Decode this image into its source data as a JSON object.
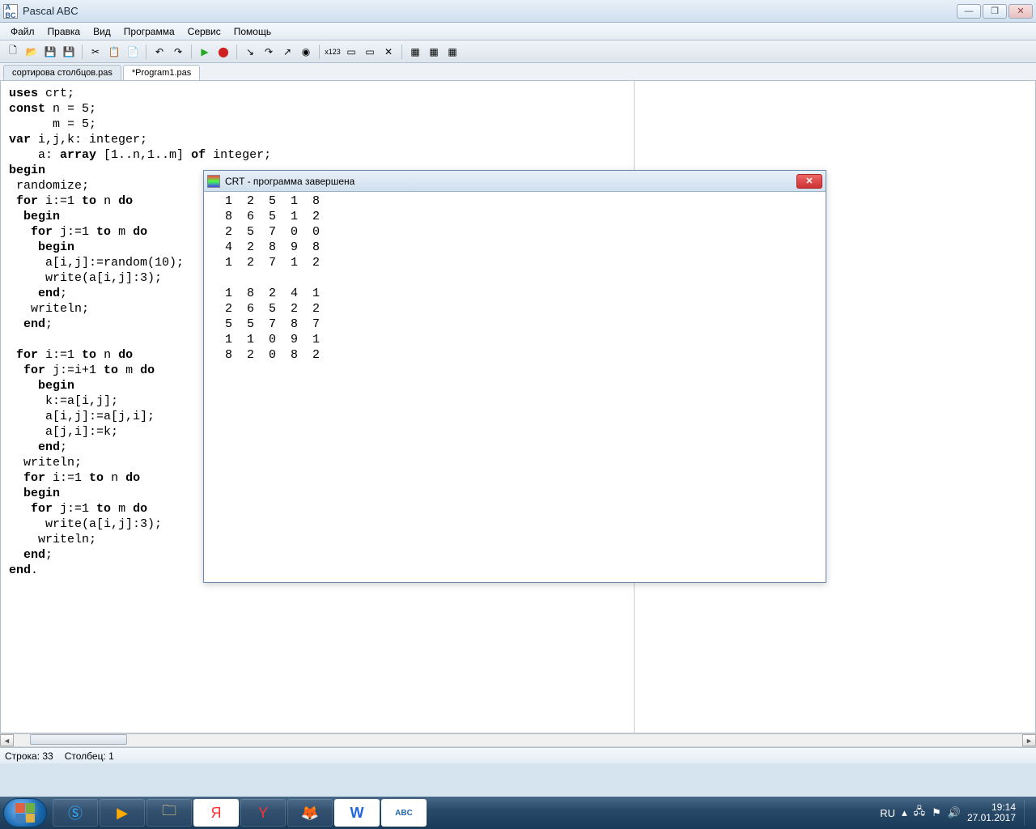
{
  "app": {
    "title": "Pascal ABC"
  },
  "menu": [
    "Файл",
    "Правка",
    "Вид",
    "Программа",
    "Сервис",
    "Помощь"
  ],
  "tabs": [
    {
      "label": "сортирова столбцов.pas",
      "active": false
    },
    {
      "label": "*Program1.pas",
      "active": true
    }
  ],
  "code_lines": [
    [
      [
        "kw",
        "uses"
      ],
      [
        "",
        " crt;"
      ]
    ],
    [
      [
        "kw",
        "const"
      ],
      [
        "",
        " n = 5;"
      ]
    ],
    [
      [
        "",
        "      m = 5;"
      ]
    ],
    [
      [
        "kw",
        "var"
      ],
      [
        "",
        " i,j,k: integer;"
      ]
    ],
    [
      [
        "",
        "    a: "
      ],
      [
        "kw",
        "array"
      ],
      [
        "",
        " [1..n,1..m] "
      ],
      [
        "kw",
        "of"
      ],
      [
        "",
        " integer;"
      ]
    ],
    [
      [
        "kw",
        "begin"
      ]
    ],
    [
      [
        "",
        " randomize;"
      ]
    ],
    [
      [
        "",
        " "
      ],
      [
        "kw",
        "for"
      ],
      [
        "",
        " i:=1 "
      ],
      [
        "kw",
        "to"
      ],
      [
        "",
        " n "
      ],
      [
        "kw",
        "do"
      ]
    ],
    [
      [
        "",
        "  "
      ],
      [
        "kw",
        "begin"
      ]
    ],
    [
      [
        "",
        "   "
      ],
      [
        "kw",
        "for"
      ],
      [
        "",
        " j:=1 "
      ],
      [
        "kw",
        "to"
      ],
      [
        "",
        " m "
      ],
      [
        "kw",
        "do"
      ]
    ],
    [
      [
        "",
        "    "
      ],
      [
        "kw",
        "begin"
      ]
    ],
    [
      [
        "",
        "     a[i,j]:=random(10);"
      ]
    ],
    [
      [
        "",
        "     write(a[i,j]:3);"
      ]
    ],
    [
      [
        "",
        "    "
      ],
      [
        "kw",
        "end"
      ],
      [
        "",
        ";"
      ]
    ],
    [
      [
        "",
        "   writeln;"
      ]
    ],
    [
      [
        "",
        "  "
      ],
      [
        "kw",
        "end"
      ],
      [
        "",
        ";"
      ]
    ],
    [
      [
        "",
        ""
      ]
    ],
    [
      [
        "",
        " "
      ],
      [
        "kw",
        "for"
      ],
      [
        "",
        " i:=1 "
      ],
      [
        "kw",
        "to"
      ],
      [
        "",
        " n "
      ],
      [
        "kw",
        "do"
      ]
    ],
    [
      [
        "",
        "  "
      ],
      [
        "kw",
        "for"
      ],
      [
        "",
        " j:=i+1 "
      ],
      [
        "kw",
        "to"
      ],
      [
        "",
        " m "
      ],
      [
        "kw",
        "do"
      ]
    ],
    [
      [
        "",
        "    "
      ],
      [
        "kw",
        "begin"
      ]
    ],
    [
      [
        "",
        "     k:=a[i,j];"
      ]
    ],
    [
      [
        "",
        "     a[i,j]:=a[j,i];"
      ]
    ],
    [
      [
        "",
        "     a[j,i]:=k;"
      ]
    ],
    [
      [
        "",
        "    "
      ],
      [
        "kw",
        "end"
      ],
      [
        "",
        ";"
      ]
    ],
    [
      [
        "",
        "  writeln;"
      ]
    ],
    [
      [
        "",
        "  "
      ],
      [
        "kw",
        "for"
      ],
      [
        "",
        " i:=1 "
      ],
      [
        "kw",
        "to"
      ],
      [
        "",
        " n "
      ],
      [
        "kw",
        "do"
      ]
    ],
    [
      [
        "",
        "  "
      ],
      [
        "kw",
        "begin"
      ]
    ],
    [
      [
        "",
        "   "
      ],
      [
        "kw",
        "for"
      ],
      [
        "",
        " j:=1 "
      ],
      [
        "kw",
        "to"
      ],
      [
        "",
        " m "
      ],
      [
        "kw",
        "do"
      ]
    ],
    [
      [
        "",
        "     write(a[i,j]:3);"
      ]
    ],
    [
      [
        "",
        "    writeln;"
      ]
    ],
    [
      [
        "",
        "  "
      ],
      [
        "kw",
        "end"
      ],
      [
        "",
        ";"
      ]
    ],
    [
      [
        "kw",
        "end"
      ],
      [
        "",
        "."
      ]
    ]
  ],
  "crt": {
    "title": "CRT - программа завершена",
    "output": "  1  2  5  1  8\n  8  6  5  1  2\n  2  5  7  0  0\n  4  2  8  9  8\n  1  2  7  1  2\n\n  1  8  2  4  1\n  2  6  5  2  2\n  5  5  7  8  7\n  1  1  0  9  1\n  8  2  0  8  2"
  },
  "status": {
    "line_label": "Строка: 33",
    "col_label": "Столбец: 1"
  },
  "tray": {
    "lang": "RU",
    "time": "19:14",
    "date": "27.01.2017"
  }
}
